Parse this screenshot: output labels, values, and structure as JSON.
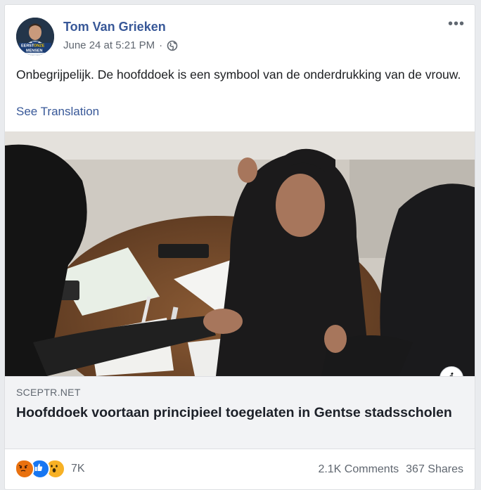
{
  "post": {
    "author": "Tom Van Grieken",
    "timestamp": "June 24 at 5:21 PM",
    "separator": "·",
    "privacy_icon": "globe-icon",
    "avatar_badge": [
      "EERST",
      "ONZE",
      "MENSEN"
    ],
    "more_label": "•••",
    "text": "Onbegrijpelijk. De hoofddoek is een symbool van de onderdrukking van de vrouw.",
    "see_translation": "See Translation"
  },
  "link": {
    "info_label": "i",
    "domain": "SCEPTR.NET",
    "title": "Hoofddoek voortaan principieel toegelaten in Gentse stadsscholen"
  },
  "engagement": {
    "reactions": [
      "angry-reaction-icon",
      "like-reaction-icon",
      "wow-reaction-icon"
    ],
    "reaction_count": "7K",
    "comments": "2.1K Comments",
    "shares": "367 Shares"
  },
  "colors": {
    "link_blue": "#385898",
    "meta_gray": "#606770",
    "like_blue": "#1877f2",
    "angry_orange": "#e9710f",
    "wow_yellow": "#f7b125"
  }
}
